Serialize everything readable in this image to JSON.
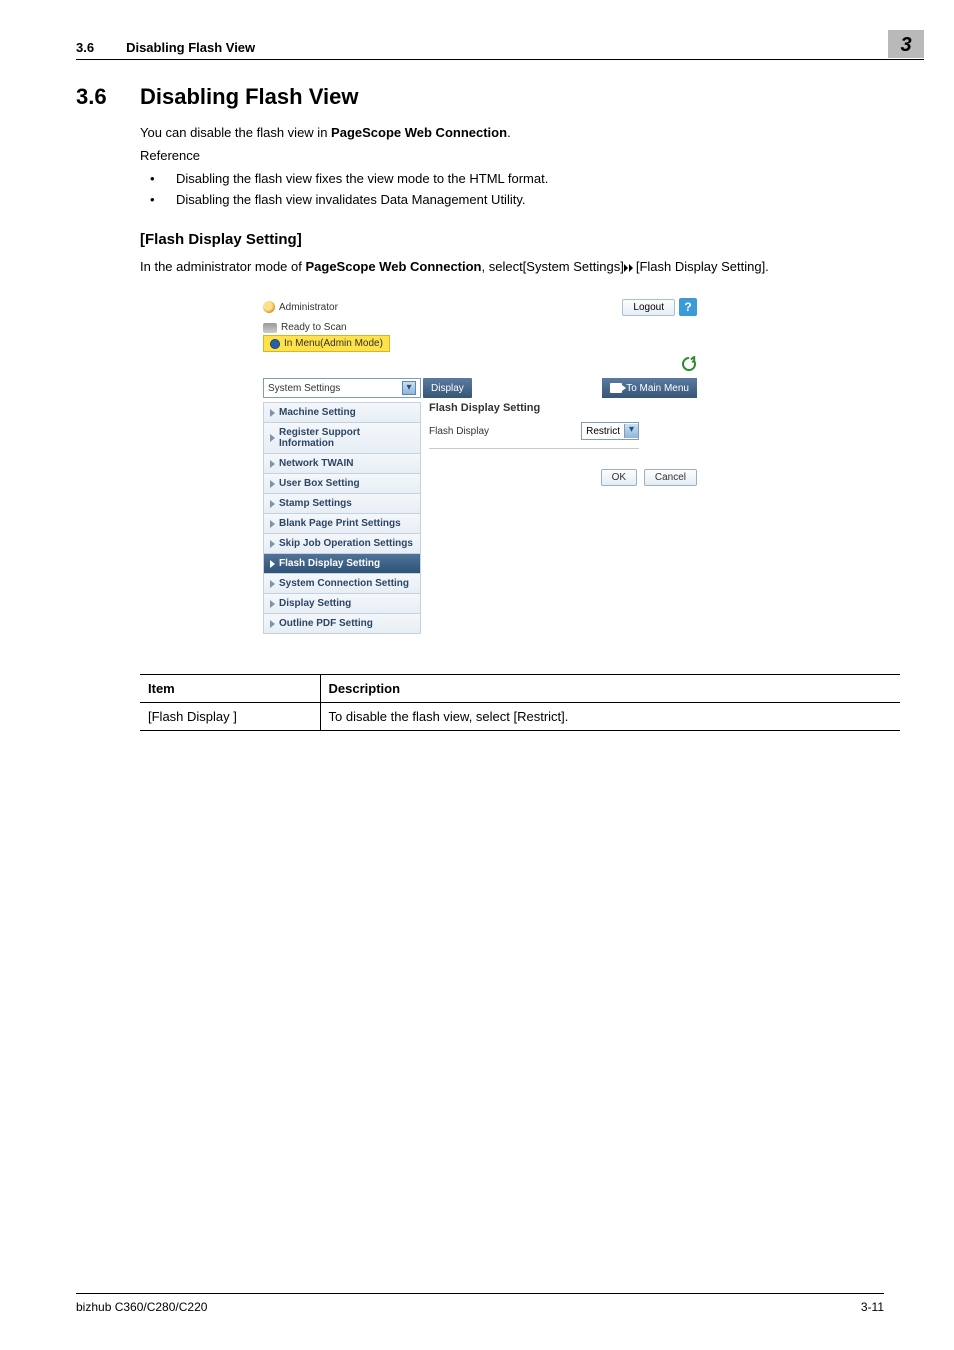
{
  "header": {
    "num": "3.6",
    "title": "Disabling Flash View"
  },
  "chapter_num": "3",
  "h1": {
    "num": "3.6",
    "title": "Disabling Flash View"
  },
  "intro_line_pre": "You can disable the flash view in ",
  "intro_line_bold": "PageScope Web Connection",
  "intro_line_post": ".",
  "reference_label": "Reference",
  "bullets": [
    "Disabling the flash view fixes the view mode to the HTML format.",
    "Disabling the flash view invalidates Data Management Utility."
  ],
  "subhead": "[Flash Display Setting]",
  "subtext_pre": "In the administrator mode of ",
  "subtext_bold": "PageScope Web Connection",
  "subtext_mid": ", select[System Settings]",
  "subtext_post": "[Flash Display Setting].",
  "screenshot": {
    "admin_label": "Administrator",
    "logout": "Logout",
    "help": "?",
    "status_ready": "Ready to Scan",
    "in_menu": "In Menu(Admin Mode)",
    "select_value": "System Settings",
    "display_btn": "Display",
    "to_main_menu": "To Main Menu",
    "sidebar": [
      "Machine Setting",
      "Register Support Information",
      "Network TWAIN",
      "User Box Setting",
      "Stamp Settings",
      "Blank Page Print Settings",
      "Skip Job Operation Settings",
      "Flash Display Setting",
      "System Connection Setting",
      "Display Setting",
      "Outline PDF Setting"
    ],
    "main_title": "Flash Display Setting",
    "main_label": "Flash Display",
    "dropdown_value": "Restrict",
    "ok": "OK",
    "cancel": "Cancel"
  },
  "table": {
    "h_item": "Item",
    "h_desc": "Description",
    "row_item": "[Flash Display ]",
    "row_desc": "To disable the flash view, select [Restrict]."
  },
  "footer": {
    "left": "bizhub C360/C280/C220",
    "right": "3-11"
  }
}
